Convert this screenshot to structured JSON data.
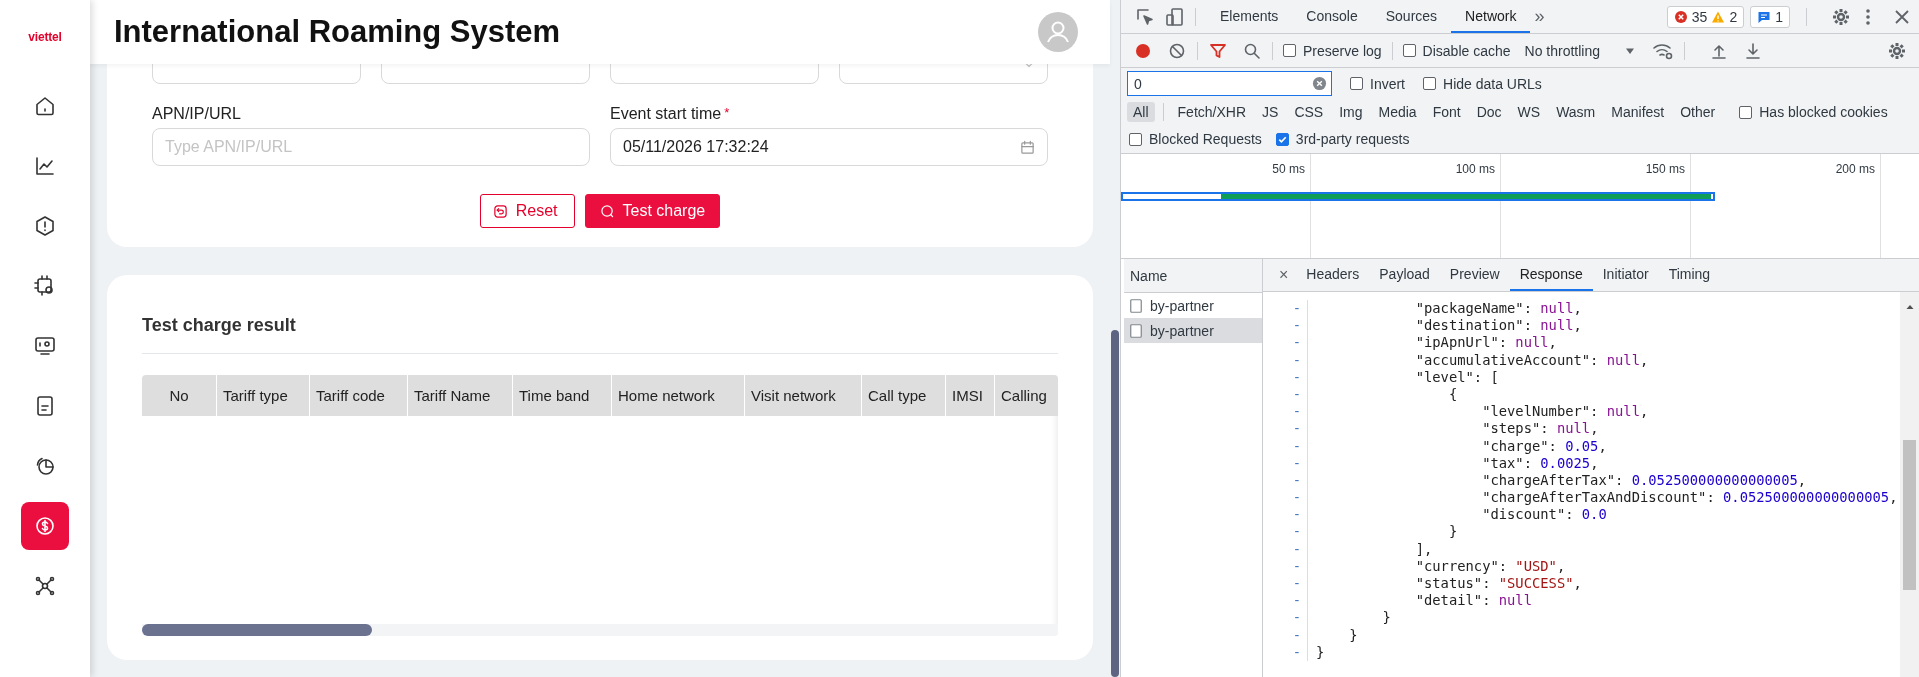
{
  "sidebar": {
    "logo": "viettel",
    "items": [
      {
        "kind": "home",
        "selected": false
      },
      {
        "kind": "chart",
        "selected": false
      },
      {
        "kind": "alert",
        "selected": false
      },
      {
        "kind": "chip",
        "selected": false
      },
      {
        "kind": "monitor",
        "selected": false
      },
      {
        "kind": "document",
        "selected": false
      },
      {
        "kind": "pie",
        "selected": false
      },
      {
        "kind": "dollar",
        "selected": true
      },
      {
        "kind": "network",
        "selected": false
      }
    ]
  },
  "header": {
    "title": "International Roaming System"
  },
  "form": {
    "top_fields": [
      {
        "kind": "text"
      },
      {
        "kind": "text"
      },
      {
        "kind": "text"
      },
      {
        "kind": "select"
      }
    ],
    "fields": [
      {
        "kind": "text",
        "label": "APN/IP/URL",
        "placeholder": "Type APN/IP/URL"
      },
      {
        "kind": "date",
        "label": "Event start time",
        "required_mark": "*",
        "value": "05/11/2026 17:32:24"
      }
    ],
    "buttons": [
      {
        "kind": "secondary",
        "label": "Reset"
      },
      {
        "kind": "primary",
        "label": "Test charge"
      }
    ]
  },
  "result": {
    "title": "Test charge result",
    "columns": [
      "No",
      "Tariff type",
      "Tariff code",
      "Tariff Name",
      "Time band",
      "Home network",
      "Visit network",
      "Call type",
      "IMSI",
      "Calling"
    ]
  },
  "devtools": {
    "tabs": [
      {
        "label": "Elements",
        "selected": false
      },
      {
        "label": "Console",
        "selected": false
      },
      {
        "label": "Sources",
        "selected": false
      },
      {
        "label": "Network",
        "selected": true
      }
    ],
    "more": "»",
    "errors": "35",
    "warnings": "2",
    "messages": "1",
    "recording": true,
    "toolbar_checks": [
      {
        "label": "Preserve log",
        "checked": false
      },
      {
        "label": "Disable cache",
        "checked": false
      }
    ],
    "throttling": "No throttling",
    "filter": {
      "value": "0"
    },
    "filter_checks": [
      {
        "label": "Invert",
        "checked": false
      },
      {
        "label": "Hide data URLs",
        "checked": false
      }
    ],
    "types": [
      {
        "label": "All",
        "selected": true
      },
      {
        "label": "Fetch/XHR",
        "selected": false
      },
      {
        "label": "JS",
        "selected": false
      },
      {
        "label": "CSS",
        "selected": false
      },
      {
        "label": "Img",
        "selected": false
      },
      {
        "label": "Media",
        "selected": false
      },
      {
        "label": "Font",
        "selected": false
      },
      {
        "label": "Doc",
        "selected": false
      },
      {
        "label": "WS",
        "selected": false
      },
      {
        "label": "Wasm",
        "selected": false
      },
      {
        "label": "Manifest",
        "selected": false
      },
      {
        "label": "Other",
        "selected": false
      }
    ],
    "type_checks": [
      {
        "label": "Has blocked cookies",
        "checked": false
      }
    ],
    "request_checks": [
      {
        "label": "Blocked Requests",
        "checked": false
      },
      {
        "label": "3rd-party requests",
        "checked": true
      }
    ],
    "timeline": {
      "ticks": [
        "50 ms",
        "100 ms",
        "150 ms",
        "200 ms"
      ]
    },
    "requests": {
      "column": "Name",
      "rows": [
        {
          "name": "by-partner",
          "selected": false
        },
        {
          "name": "by-partner",
          "selected": true
        }
      ]
    },
    "detail": {
      "close": "×",
      "tabs": [
        {
          "label": "Headers",
          "selected": false
        },
        {
          "label": "Payload",
          "selected": false
        },
        {
          "label": "Preview",
          "selected": false
        },
        {
          "label": "Response",
          "selected": true
        },
        {
          "label": "Initiator",
          "selected": false
        },
        {
          "label": "Timing",
          "selected": false
        }
      ]
    },
    "response": [
      {
        "gutter": "-",
        "text": "            \"packageName\": ",
        "value": "null",
        "kind": "null",
        "tail": ","
      },
      {
        "gutter": "-",
        "text": "            \"destination\": ",
        "value": "null",
        "kind": "null",
        "tail": ","
      },
      {
        "gutter": "-",
        "text": "            \"ipApnUrl\": ",
        "value": "null",
        "kind": "null",
        "tail": ","
      },
      {
        "gutter": "-",
        "text": "            \"accumulativeAccount\": ",
        "value": "null",
        "kind": "null",
        "tail": ","
      },
      {
        "gutter": "-",
        "text": "            \"level\": ["
      },
      {
        "gutter": "-",
        "text": "                {"
      },
      {
        "gutter": "-",
        "text": "                    \"levelNumber\": ",
        "value": "null",
        "kind": "null",
        "tail": ","
      },
      {
        "gutter": "-",
        "text": "                    \"steps\": ",
        "value": "null",
        "kind": "null",
        "tail": ","
      },
      {
        "gutter": "-",
        "text": "                    \"charge\": ",
        "value": "0.05",
        "kind": "number",
        "tail": ","
      },
      {
        "gutter": "-",
        "text": "                    \"tax\": ",
        "value": "0.0025",
        "kind": "number",
        "tail": ","
      },
      {
        "gutter": "-",
        "text": "                    \"chargeAfterTax\": ",
        "value": "0.052500000000000005",
        "kind": "number",
        "tail": ","
      },
      {
        "gutter": "-",
        "text": "                    \"chargeAfterTaxAndDiscount\": ",
        "value": "0.052500000000000005",
        "kind": "number",
        "tail": ","
      },
      {
        "gutter": "-",
        "text": "                    \"discount\": ",
        "value": "0.0",
        "kind": "number"
      },
      {
        "gutter": "-",
        "text": "                }"
      },
      {
        "gutter": "-",
        "text": "            ],"
      },
      {
        "gutter": "-",
        "text": "            \"currency\": ",
        "value": "\"USD\"",
        "kind": "string",
        "tail": ","
      },
      {
        "gutter": "-",
        "text": "            \"status\": ",
        "value": "\"SUCCESS\"",
        "kind": "string",
        "tail": ","
      },
      {
        "gutter": "-",
        "text": "            \"detail\": ",
        "value": "null",
        "kind": "null"
      },
      {
        "gutter": "-",
        "text": "        }"
      },
      {
        "gutter": "-",
        "text": "    }"
      },
      {
        "gutter": "-",
        "text": "}"
      }
    ]
  }
}
